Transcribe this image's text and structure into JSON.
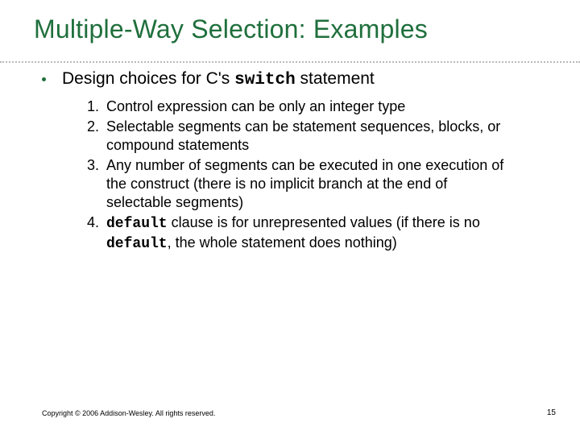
{
  "title": "Multiple-Way Selection: Examples",
  "bullet": {
    "pre": "Design choices for C's ",
    "code": "switch",
    "post": " statement"
  },
  "items": {
    "i1": "Control expression can be only an integer type",
    "i2": "Selectable segments can be statement sequences, blocks, or compound statements",
    "i3": "Any number of segments can be executed in one execution of the construct (there is no implicit branch at the end of selectable segments)",
    "i4_code1": "default",
    "i4_mid1": " clause is for unrepresented values (if there is no ",
    "i4_code2": "default",
    "i4_mid2": ", the whole statement does nothing)"
  },
  "footer": "Copyright © 2006 Addison-Wesley. All rights reserved.",
  "page": "15"
}
